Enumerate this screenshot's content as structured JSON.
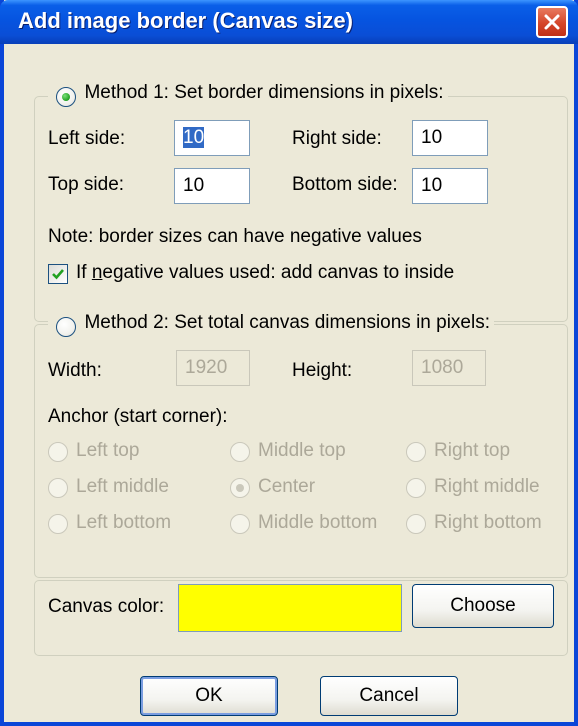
{
  "window": {
    "title": "Add image border (Canvas size)"
  },
  "method1": {
    "label": "Method 1: Set border dimensions in pixels:",
    "selected": true,
    "left_label": "Left side:",
    "left_value": "10",
    "right_label": "Right side:",
    "right_value": "10",
    "top_label": "Top side:",
    "top_value": "10",
    "bottom_label": "Bottom side:",
    "bottom_value": "10",
    "note": "Note: border sizes can have negative values",
    "checkbox_label_pre": "If ",
    "checkbox_label_accel": "n",
    "checkbox_label_post": "egative values used: add canvas to inside",
    "checkbox_checked": true
  },
  "method2": {
    "label": "Method 2: Set total canvas dimensions in pixels:",
    "selected": false,
    "width_label": "Width:",
    "width_value": "1920",
    "height_label": "Height:",
    "height_value": "1080",
    "anchor_label": "Anchor (start corner):",
    "anchors": {
      "left_top": "Left top",
      "middle_top": "Middle top",
      "right_top": "Right top",
      "left_middle": "Left middle",
      "center": "Center",
      "right_middle": "Right middle",
      "left_bottom": "Left bottom",
      "middle_bottom": "Middle bottom",
      "right_bottom": "Right bottom"
    },
    "selected_anchor": "Center"
  },
  "canvas": {
    "label": "Canvas color:",
    "color": "#ffff00",
    "choose_label": "Choose"
  },
  "buttons": {
    "ok": "OK",
    "cancel": "Cancel"
  },
  "colors": {
    "titlebar": "#0a5fe8",
    "dialog_bg": "#ece9d8",
    "close": "#d5462a"
  }
}
